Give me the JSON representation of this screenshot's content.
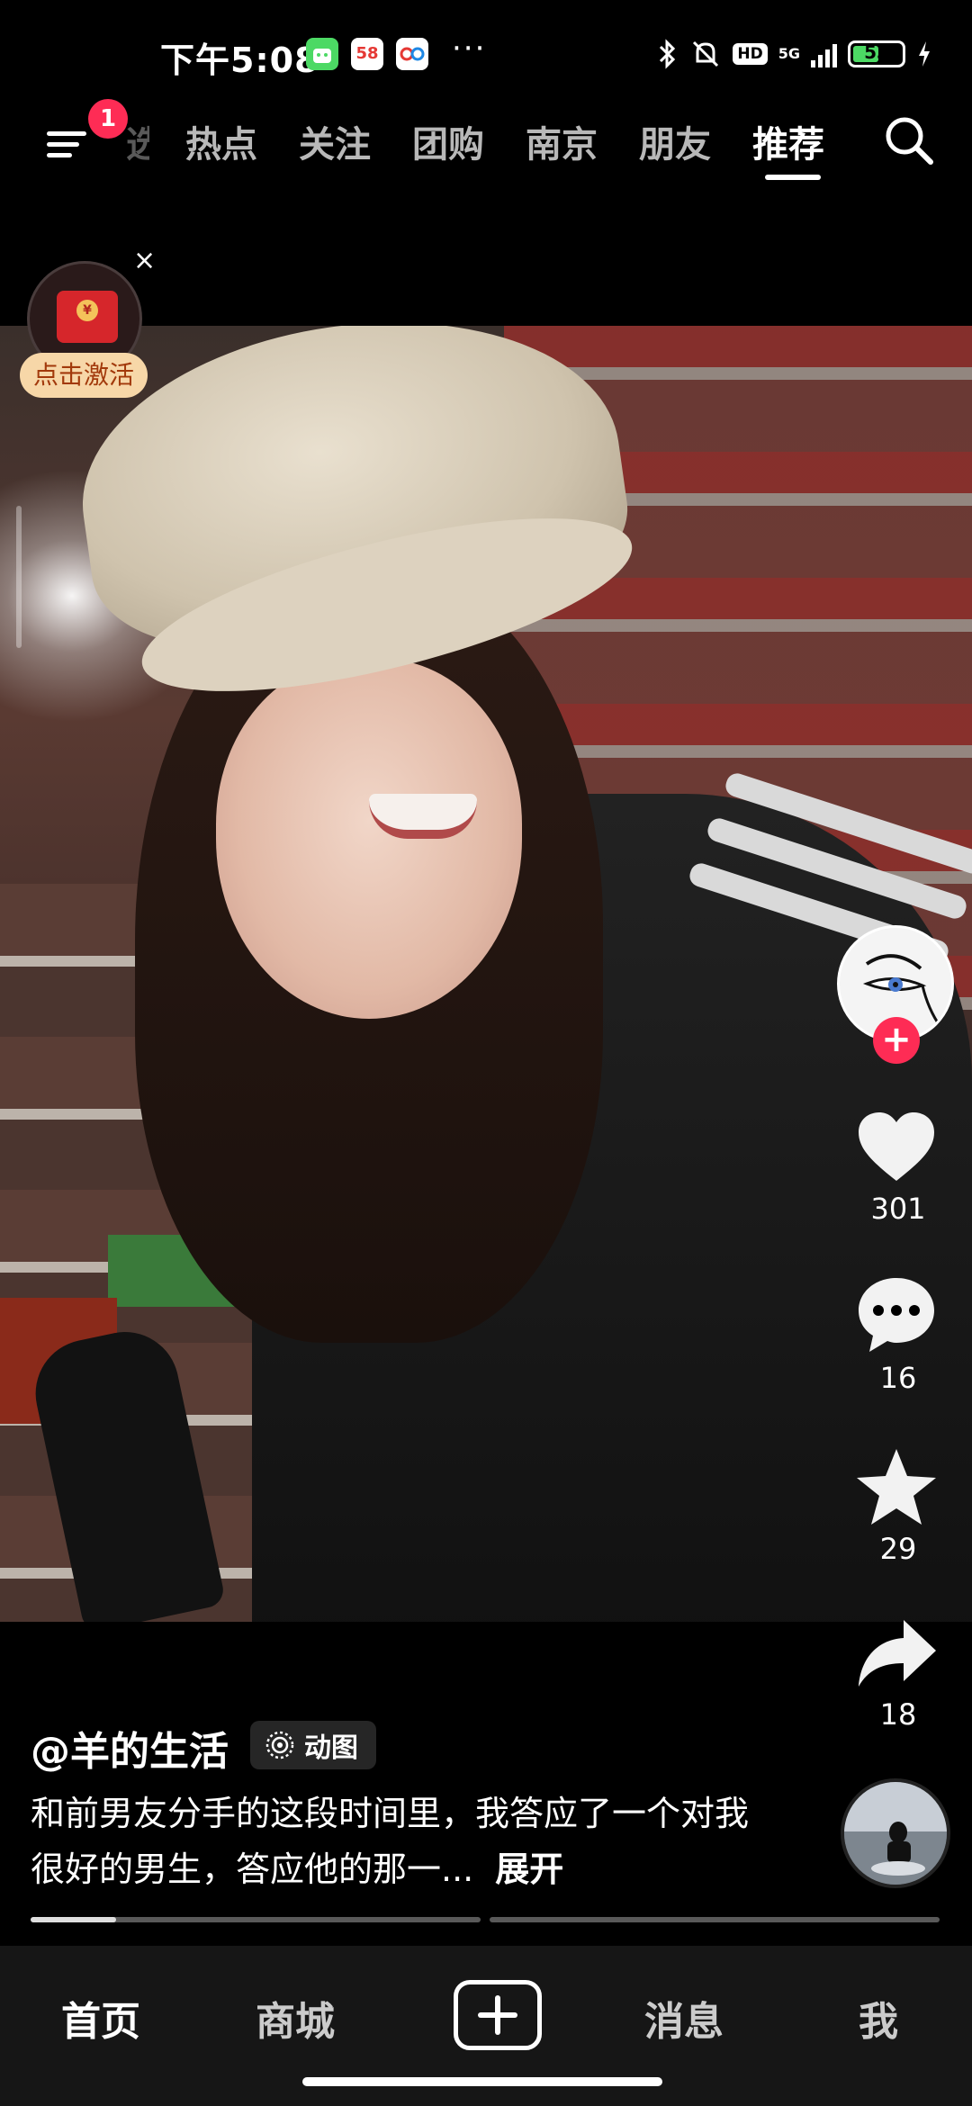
{
  "status_bar": {
    "time": "下午5:08",
    "apps": [
      {
        "name": "app-android-icon",
        "text": "",
        "color": "#4cd964"
      },
      {
        "name": "app-58-icon",
        "text": "58",
        "color": "#ffffff"
      },
      {
        "name": "app-baidu-icon",
        "text": "",
        "color": "#ffffff"
      }
    ],
    "more": "···",
    "network": "5G",
    "hd": "HD",
    "battery_level": "53",
    "battery_fraction": 0.53
  },
  "top_nav": {
    "notification_count": "1",
    "partial_tab": "选",
    "tabs": [
      "热点",
      "关注",
      "团购",
      "南京",
      "朋友",
      "推荐"
    ],
    "active_tab": "推荐"
  },
  "red_packet": {
    "label": "点击激活",
    "close": "×",
    "coin": "¥"
  },
  "sidebar": {
    "likes": "301",
    "comments": "16",
    "favorites": "29",
    "shares": "18",
    "follow": "+"
  },
  "post": {
    "author": "@羊的生活",
    "tag": "动图",
    "description": "和前男友分手的这段时间里，我答应了一个对我很好的男生，答应他的那一...",
    "expand": "展开",
    "progress_segments": [
      0.19,
      0
    ]
  },
  "bottom_tabs": {
    "home": "首页",
    "mall": "商城",
    "messages": "消息",
    "me": "我"
  },
  "colors": {
    "accent": "#fe2c55",
    "battery": "#4cd964",
    "redpacket_label_bg": "#f7d7a8"
  }
}
